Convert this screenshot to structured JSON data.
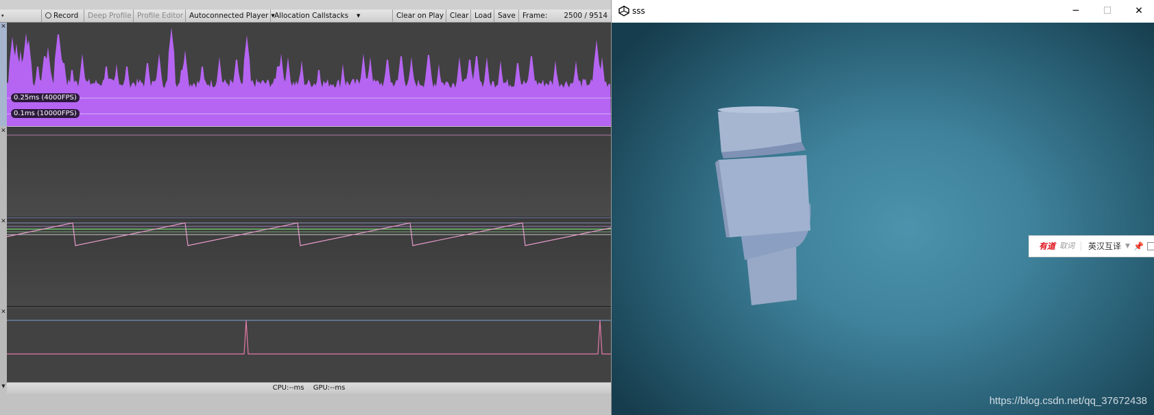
{
  "profiler": {
    "toolbar": {
      "record": "Record",
      "deep_profile": "Deep Profile",
      "profile_editor": "Profile Editor",
      "connected_player": "Autoconnected Player",
      "allocation_callstacks": "Allocation Callstacks",
      "clear_on_play": "Clear on Play",
      "clear": "Clear",
      "load": "Load",
      "save": "Save",
      "frame_label": "Frame:",
      "frame_value": "2500 / 9514"
    },
    "cpu_lane": {
      "fps_label_1": "0.25ms (4000FPS)",
      "fps_label_2": "0.1ms (10000FPS)",
      "fill_color": "#b565f2"
    },
    "status": {
      "cpu": "CPU:--ms",
      "gpu": "GPU:--ms"
    }
  },
  "game_window": {
    "title": "sss",
    "controls": {
      "minimize": "─",
      "maximize": "☐",
      "close": "✕"
    },
    "popup": {
      "logo": "有道",
      "word": "取词",
      "mode": "英汉互译"
    },
    "watermark": "https://blog.csdn.net/qq_37672438"
  }
}
